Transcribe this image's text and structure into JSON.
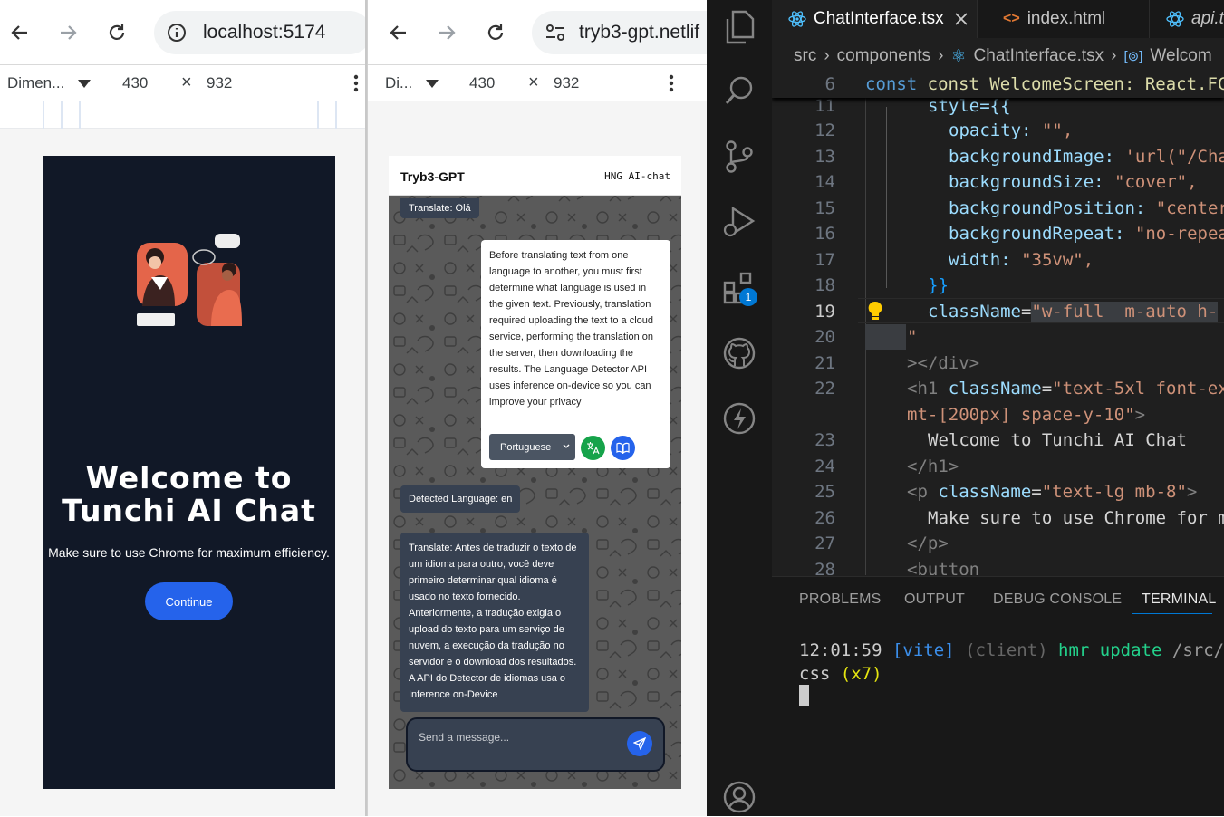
{
  "browser_a": {
    "url": "localhost:5174",
    "device_label": "Dimen...",
    "width": "430",
    "times": "×",
    "height": "932",
    "welcome_line1": "Welcome to",
    "welcome_line2": "Tunchi AI Chat",
    "subtitle": "Make sure to use Chrome for maximum efficiency.",
    "continue_label": "Continue"
  },
  "browser_b": {
    "url": "tryb3-gpt.netlif",
    "device_label": "Di...",
    "width": "430",
    "times": "×",
    "height": "932",
    "chat_title": "Tryb3-GPT",
    "chat_subtitle": "HNG AI-chat",
    "messages": [
      {
        "role": "bot",
        "text": "Translate: Olá"
      },
      {
        "role": "user",
        "text": "Before translating text from one language to another, you must first determine what language is used in the given text. Previously, translation required uploading the text to a cloud service, performing the translation on the server, then downloading the results. The Language Detector API uses inference on-device so you can improve your privacy"
      },
      {
        "role": "bot",
        "text": "Detected Language: en"
      },
      {
        "role": "bot",
        "text": "Translate: Antes de traduzir o texto de um idioma para outro, você deve primeiro determinar qual idioma é usado no texto fornecido. Anteriormente, a tradução exigia o upload do texto para um serviço de nuvem, a execução da tradução no servidor e o download dos resultados. A API do Detector de idiomas usa o Inference on-Device"
      }
    ],
    "language_selected": "Portuguese",
    "input_placeholder": "Send a message..."
  },
  "vscode": {
    "tabs": [
      {
        "label": "ChatInterface.tsx",
        "active": true
      },
      {
        "label": "index.html",
        "active": false
      },
      {
        "label": "api.t",
        "active": false
      }
    ],
    "breadcrumb": [
      "src",
      "components",
      "ChatInterface.tsx",
      "Welcom"
    ],
    "sticky": {
      "num": "6",
      "text": "const WelcomeScreen: React.FC<{ onC"
    },
    "line_numbers": [
      "11",
      "12",
      "13",
      "14",
      "15",
      "16",
      "17",
      "18",
      "19",
      "20",
      "21",
      "22",
      "",
      "23",
      "24",
      "25",
      "26",
      "27",
      "28"
    ],
    "code": {
      "l11": "style={{",
      "l12a": "opacity: ",
      "l12b": "\"\",",
      "l13a": "backgroundImage: ",
      "l13b": "'url(\"/Cha",
      "l14a": "backgroundSize: ",
      "l14b": "\"cover\",",
      "l15a": "backgroundPosition: ",
      "l15b": "\"center",
      "l16a": "backgroundRepeat: ",
      "l16b": "\"no-repea",
      "l17a": "width: ",
      "l17b": "\"35vw\",",
      "l18": "}}",
      "l19a": "className",
      "l19b": "=",
      "l19c": "\"w-full  m-auto h-",
      "l20": "\"",
      "l21": "></div>",
      "l22a": "<h1 ",
      "l22b": "className",
      "l22c": "\"text-5xl font-ex",
      "l22d": "mt-[200px] space-y-10\"",
      "l23": "Welcome to Tunchi AI Chat",
      "l24": "</h1>",
      "l25a": "<p ",
      "l25b": "className",
      "l25c": "\"text-lg mb-8\"",
      "l26": "Make sure to use Chrome for m",
      "l27": "</p>",
      "l28": "<button"
    },
    "badge": "1",
    "panel_tabs": [
      "PROBLEMS",
      "OUTPUT",
      "DEBUG CONSOLE",
      "TERMINAL"
    ],
    "terminal": {
      "time": "12:01:59",
      "tag": "[vite]",
      "client": "(client)",
      "msg": "hmr update",
      "path": "/src/co",
      "line2a": "css",
      "line2b": "(x7)"
    }
  }
}
